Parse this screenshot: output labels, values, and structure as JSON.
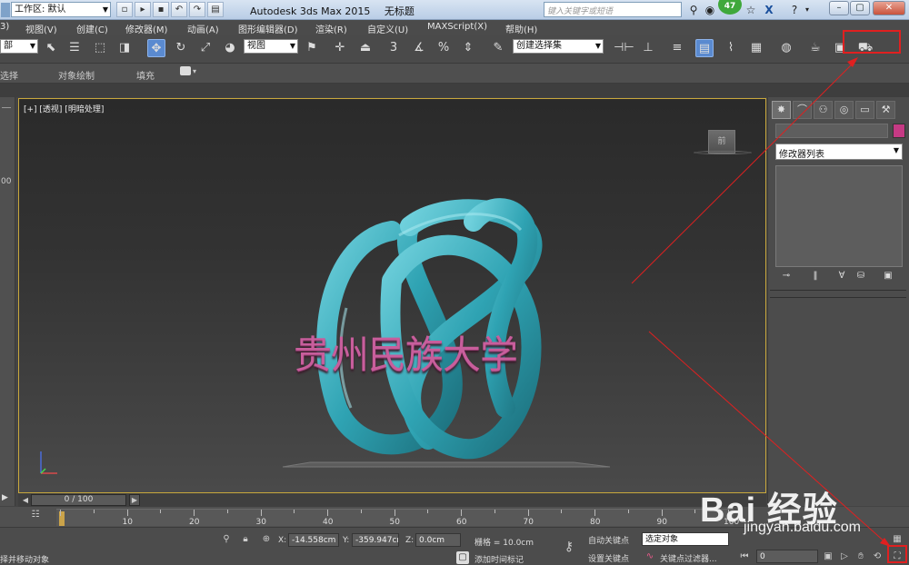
{
  "titlebar": {
    "workspace_label": "工作区: 默认",
    "app_title": "Autodesk 3ds Max  2015",
    "doc_title": "无标题",
    "search_placeholder": "键入关键字或短语",
    "badge_count": "47",
    "close_glyph": "X"
  },
  "menubar": {
    "items": [
      "3)",
      "视图(V)",
      "创建(C)",
      "修改器(M)",
      "动画(A)",
      "图形编辑器(D)",
      "渲染(R)",
      "自定义(U)",
      "MAXScript(X)",
      "帮助(H)"
    ]
  },
  "toolbar": {
    "filter_value": "部",
    "refcoord_value": "视图",
    "snap_3": "3",
    "snap_2_5": "2.5",
    "selection_set_value": "创建选择集"
  },
  "ribbon": {
    "tabs": [
      "选择",
      "对象绘制",
      "填充"
    ]
  },
  "viewport": {
    "label": "[+] [透视] [明暗处理]",
    "viewcube_label": "前",
    "text_3d": "贵州民族大学",
    "text_color": "#c85e9c",
    "knot_color": "#2fa3b3"
  },
  "leftstrip": {
    "number": "00"
  },
  "command_panel": {
    "tabs": [
      "create-icon",
      "modify-icon",
      "hierarchy-icon",
      "motion-icon",
      "display-icon",
      "utilities-icon"
    ],
    "modifier_list_label": "修改器列表",
    "object_color": "#c53a84"
  },
  "timeline": {
    "position": "0 / 100",
    "ticks": [
      "10",
      "20",
      "30",
      "40",
      "50",
      "60",
      "70",
      "80",
      "90",
      "100"
    ]
  },
  "statusbar": {
    "prompt": "择并移动对象",
    "x_label": "X:",
    "x_value": "-14.558cm",
    "y_label": "Y:",
    "y_value": "-359.947cr",
    "z_label": "Z:",
    "z_value": "0.0cm",
    "grid_label": "栅格 = 10.0cm",
    "add_time_tag": "添加时间标记",
    "auto_key": "自动关键点",
    "set_key": "设置关键点",
    "selected_object": "选定对象",
    "key_filters": "关键点过滤器...",
    "frame_value": "0"
  },
  "watermark": {
    "brand": "Bai 经验",
    "url": "jingyan.baidu.com"
  }
}
